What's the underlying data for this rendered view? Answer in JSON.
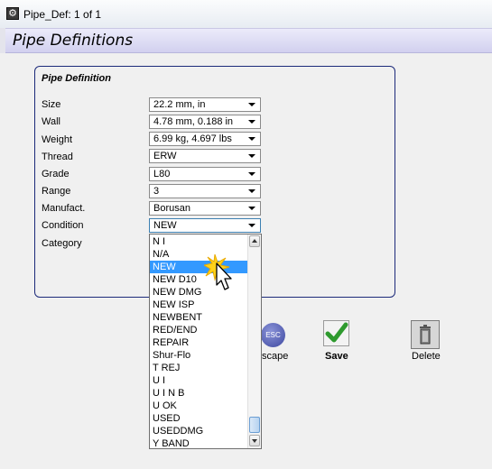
{
  "window": {
    "title": "Pipe_Def: 1 of 1"
  },
  "header": {
    "title": "Pipe Definitions"
  },
  "group": {
    "title": "Pipe Definition"
  },
  "fields": {
    "size": {
      "label": "Size",
      "value": "22.2 mm,  in"
    },
    "wall": {
      "label": "Wall",
      "value": "4.78 mm, 0.188 in"
    },
    "weight": {
      "label": "Weight",
      "value": "6.99 kg, 4.697 lbs"
    },
    "thread": {
      "label": "Thread",
      "value": "ERW"
    },
    "grade": {
      "label": "Grade",
      "value": "L80"
    },
    "range": {
      "label": "Range",
      "value": "3"
    },
    "manufact": {
      "label": "Manufact.",
      "value": "Borusan"
    },
    "condition": {
      "label": "Condition",
      "value": "NEW"
    },
    "category": {
      "label": "Category"
    }
  },
  "condition_dropdown": {
    "selected": "NEW",
    "options": [
      "N I",
      "N/A",
      "NEW",
      "NEW D10",
      "NEW DMG",
      "NEW ISP",
      "NEWBENT",
      "RED/END",
      "REPAIR",
      "Shur-Flo",
      "T REJ",
      "U I",
      "U I N B",
      "U OK",
      "USED",
      "USEDDMG",
      "Y BAND"
    ]
  },
  "toolbar": {
    "escape_icon_text": "ESC",
    "escape_label": "scape",
    "save_label": "Save",
    "delete_label": "Delete"
  },
  "colors": {
    "header_bg": "#d2d0ef",
    "group_border": "#1c2a7a",
    "selection": "#3399ff",
    "save_check": "#2e9a2e",
    "pointer_glow": "#ffd21a"
  }
}
